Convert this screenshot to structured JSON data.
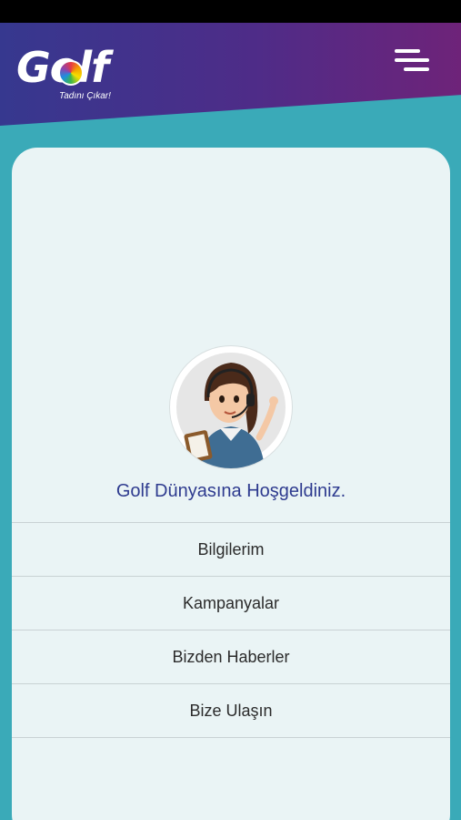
{
  "header": {
    "logo_text": "Golf",
    "logo_tagline": "Tadını Çıkar!",
    "colors": {
      "gradient_start": "#36388f",
      "gradient_end": "#6e2379",
      "background": "#3aaab8"
    }
  },
  "menu_button": {
    "icon": "hamburger-menu-icon"
  },
  "welcome": {
    "text": "Golf Dünyasına Hoşgeldiniz."
  },
  "avatar": {
    "icon": "customer-support-agent-avatar"
  },
  "menu": {
    "items": [
      {
        "label": "Bilgilerim"
      },
      {
        "label": "Kampanyalar"
      },
      {
        "label": "Bizden Haberler"
      },
      {
        "label": "Bize Ulaşın"
      }
    ]
  }
}
